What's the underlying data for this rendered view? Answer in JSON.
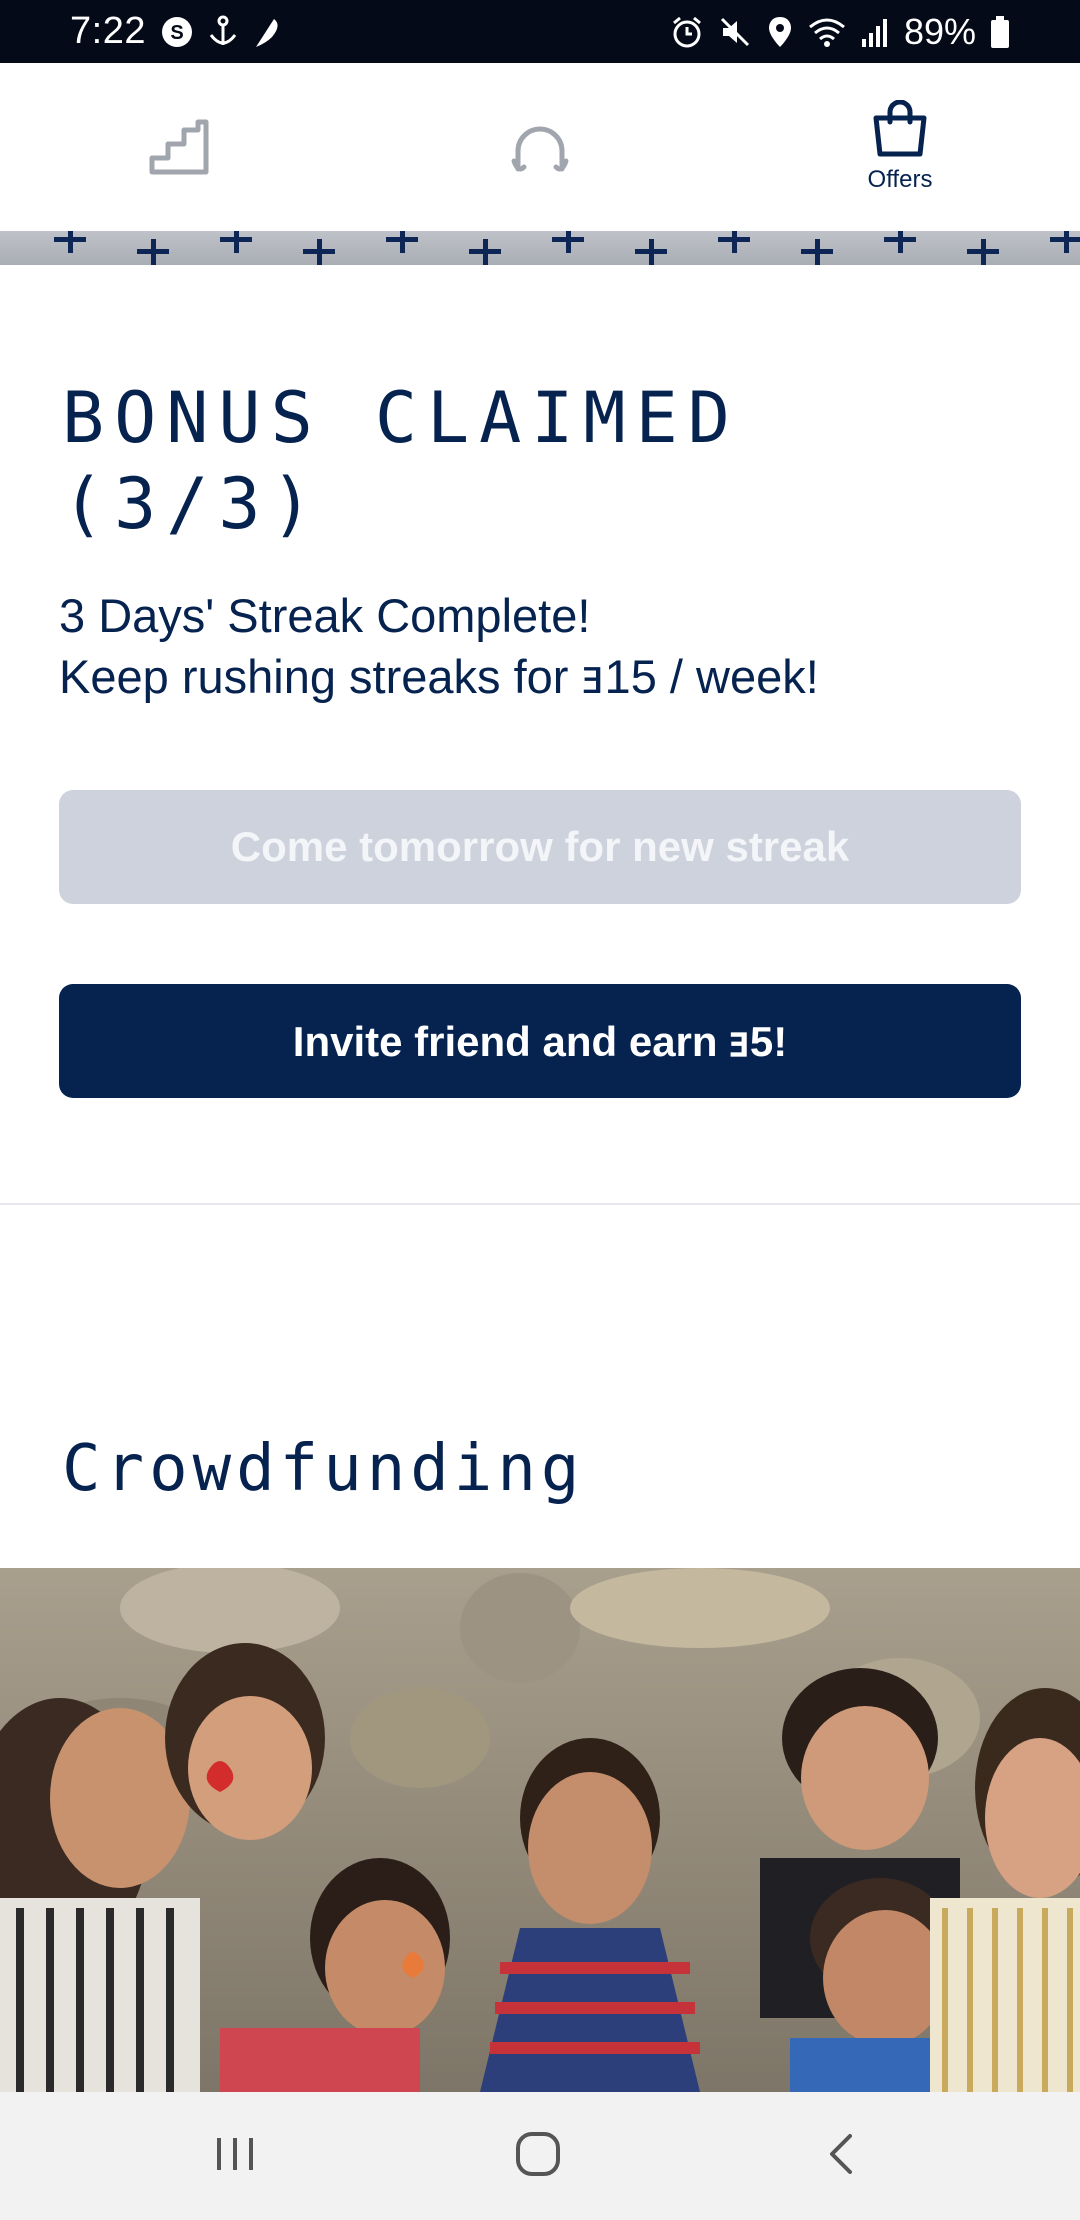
{
  "status_bar": {
    "time": "7:22",
    "battery": "89%",
    "left_icons": [
      "s-circle-icon",
      "anchor-icon",
      "feather-icon"
    ],
    "right_icons": [
      "alarm-icon",
      "mute-icon",
      "location-icon",
      "wifi-icon",
      "signal-icon",
      "battery-icon"
    ]
  },
  "top_nav": {
    "items": [
      {
        "icon": "stairs-icon",
        "label": ""
      },
      {
        "icon": "headphones-icon",
        "label": ""
      },
      {
        "icon": "shopping-bag-icon",
        "label": "Offers",
        "active": true
      }
    ]
  },
  "bonus": {
    "title": "BONUS CLAIMED (3/3)",
    "line1": "3 Days' Streak Complete!",
    "line2": "Keep rushing streaks for ⱻ15 / week!",
    "disabled_button": "Come tomorrow for new streak",
    "invite_button": "Invite friend and earn ⱻ5!"
  },
  "crowdfunding": {
    "title": "Crowdfunding",
    "image_alt": "Group of smiling children and women in front of a stone wall"
  },
  "system_nav": {
    "icons": [
      "recent-apps-icon",
      "home-icon",
      "back-icon"
    ]
  },
  "colors": {
    "primary": "#06224f",
    "disabled": "#cdd2dc",
    "status_bar": "#050a18"
  }
}
